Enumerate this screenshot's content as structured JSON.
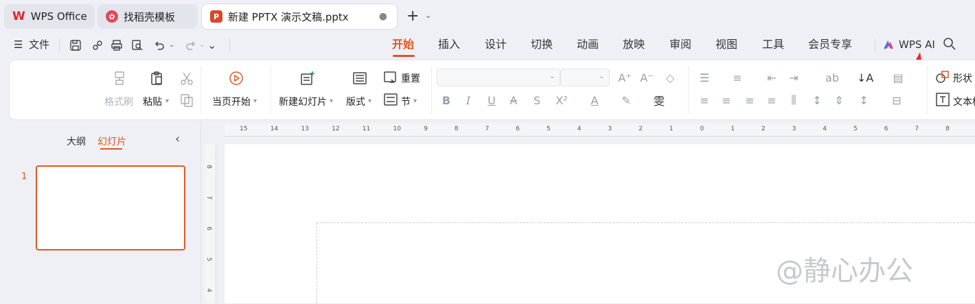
{
  "tabs": [
    {
      "label": "WPS Office",
      "icon": "wps-logo-icon",
      "color": "#e0262d"
    },
    {
      "label": "找稻壳模板",
      "icon": "docer-icon",
      "color": "#e5485a"
    },
    {
      "label": "新建 PPTX 演示文稿.pptx",
      "icon": "ppt-file-icon",
      "color": "#d9472b",
      "ticon_text": "P"
    }
  ],
  "menu": {
    "file_label": "文件",
    "tabs": [
      "开始",
      "插入",
      "设计",
      "切换",
      "动画",
      "放映",
      "审阅",
      "视图",
      "工具",
      "会员专享"
    ],
    "active_tab": "开始",
    "ai_label": "WPS AI",
    "accent": "#e0571f"
  },
  "ribbon": {
    "format_painter": "格式刷",
    "paste": "粘贴",
    "start_from_current": "当页开始",
    "new_slide": "新建幻灯片",
    "layout": "版式",
    "reset": "重置",
    "section": "节",
    "shape": "形状",
    "textbox": "文本框"
  },
  "left_panel": {
    "outline_tab": "大纲",
    "slides_tab": "幻灯片",
    "slide_number": "1"
  },
  "rulers": {
    "horizontal": [
      "15",
      "14",
      "13",
      "12",
      "11",
      "10",
      "9",
      "8",
      "7",
      "6",
      "5",
      "4",
      "3",
      "2",
      "1",
      "0",
      "1",
      "2",
      "3",
      "4",
      "5",
      "6",
      "7",
      "8"
    ],
    "vertical": [
      "8",
      "7",
      "6",
      "5",
      "4"
    ]
  },
  "watermark": "@静心办公"
}
